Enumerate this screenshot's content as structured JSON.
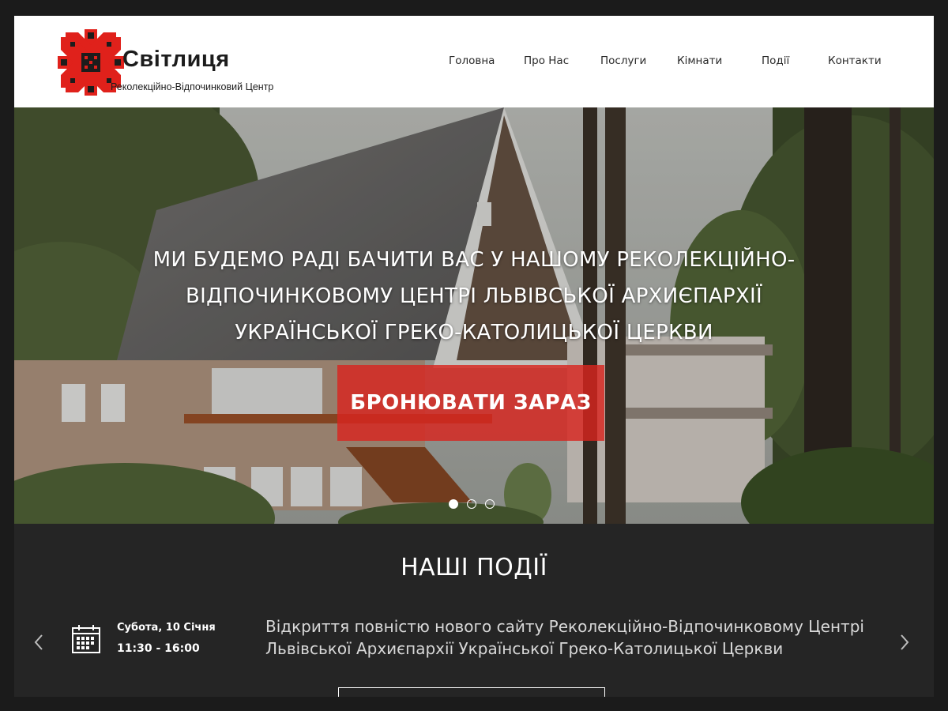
{
  "brand": {
    "title": "Світлиця",
    "subtitle": "Реколекційно-Відпочинковий Центр"
  },
  "nav": {
    "items": [
      "Головна",
      "Про Нас",
      "Послуги",
      "Кімнати",
      "Події",
      "Контакти"
    ]
  },
  "hero": {
    "heading": "Ми будемо раді бачити вас у нашому реколекційно-відпочинковому центрі Львівської Архиєпархії Української Греко-Католицької Церкви",
    "cta_label": "БРОНЮВАТИ ЗАРАЗ",
    "slides_total": 3,
    "active_slide": 1
  },
  "events": {
    "title": "НАШІ ПОДІЇ",
    "item": {
      "date": "Субота, 10 Січня",
      "time": "11:30 - 16:00",
      "text": "Відкриття повністю нового сайту Реколекційно-Відпочинковому Центрі Львівської Архиєпархії Української Греко-Католицької Церкви"
    }
  },
  "colors": {
    "accent": "#d8241e",
    "logo_black": "#1c1c1c",
    "dark_bg": "#252525",
    "header_bg": "#ffffff"
  },
  "icons": [
    "embroidery-logo-icon",
    "calendar-icon",
    "chevron-left-icon",
    "chevron-right-icon"
  ]
}
